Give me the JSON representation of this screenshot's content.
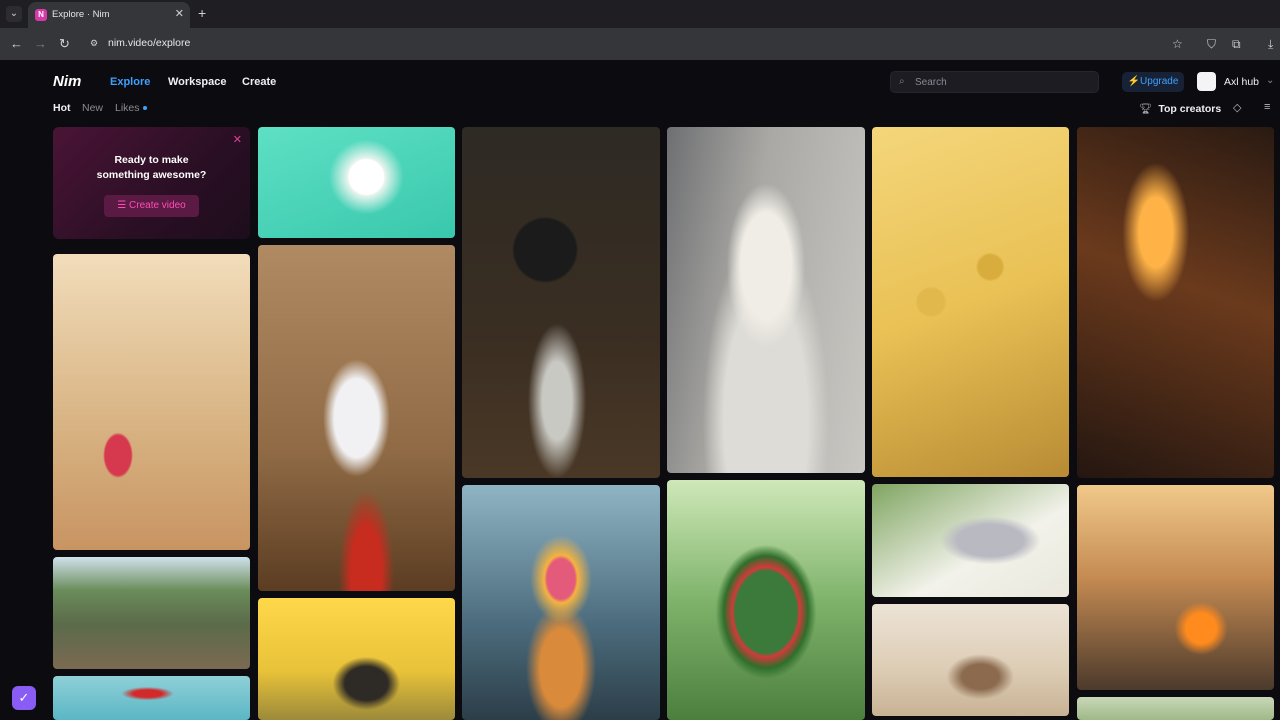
{
  "browser": {
    "tab_title": "Explore · Nim",
    "tab_favicon": "N",
    "url": "nim.video/explore",
    "icons": [
      "tab-switch-icon",
      "close-icon",
      "new-tab-icon",
      "back-icon",
      "forward-icon",
      "reload-icon",
      "site-settings-icon",
      "bookmark-star-icon",
      "shield-icon",
      "extensions-icon",
      "download-icon"
    ]
  },
  "header": {
    "logo": "Nim",
    "nav": [
      {
        "label": "Explore",
        "active": true
      },
      {
        "label": "Workspace",
        "active": false
      },
      {
        "label": "Create",
        "active": false
      }
    ],
    "search_placeholder": "Search",
    "upgrade_label": "Upgrade",
    "username": "Axl hub"
  },
  "filters": [
    {
      "label": "Hot",
      "active": true
    },
    {
      "label": "New",
      "active": false
    },
    {
      "label": "Likes",
      "active": false
    }
  ],
  "top_creators_label": "Top creators",
  "promo": {
    "line1": "Ready to make",
    "line2": "something awesome?",
    "button_label": "Create video"
  },
  "gallery": [
    "Rabbit with sunglasses on teal background",
    "Bulldog in top hat in a study",
    "White cat in car seat",
    "Cheese block with miniature workers",
    "Bread train on tracks",
    "Girl with puppy in street",
    "Rabbit chopping vegetables",
    "Kittens under umbrella",
    "Watermelon waterfall",
    "Silver wolf in leaves",
    "Man on bicycle with demon biker",
    "Village path",
    "Girl in yellow flowers",
    "Woman with guitar in desert",
    "Red figure on teal sky",
    "Green landscape"
  ],
  "colors": {
    "accent": "#3ea0ff",
    "promo_pink": "#ff4fb3",
    "background": "#0c0c10"
  }
}
